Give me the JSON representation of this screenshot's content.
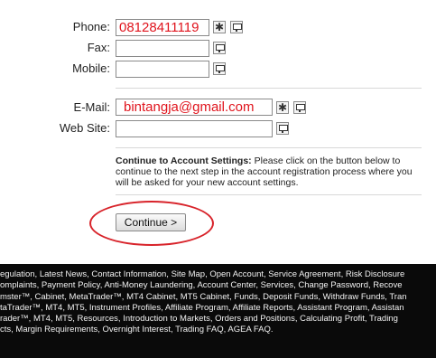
{
  "form": {
    "phone": {
      "label": "Phone:",
      "value": "08128411119"
    },
    "fax": {
      "label": "Fax:",
      "value": ""
    },
    "mobile": {
      "label": "Mobile:",
      "value": ""
    },
    "email": {
      "label": "E-Mail:",
      "value": "bintangja@gmail.com"
    },
    "website": {
      "label": "Web Site:",
      "value": ""
    },
    "required_glyph": "✱"
  },
  "note": {
    "heading": "Continue to Account Settings:",
    "text": " Please click on the button below to continue to the next step in the account registration process where you will be asked for your new account settings."
  },
  "continue_button": "Continue >",
  "footer_lines": [
    "egulation, Latest News, Contact Information, Site Map, Open Account, Service Agreement, Risk Disclosure",
    "omplaints, Payment Policy, Anti-Money Laundering, Account Center, Services, Change Password, Recove",
    "mster™, Cabinet, MetaTrader™, MT4 Cabinet, MT5 Cabinet, Funds, Deposit Funds, Withdraw Funds, Tran",
    "taTrader™, MT4, MT5, Instrument Profiles, Affiliate Program, Affiliate Reports, Assistant Program, Assistan",
    "rader™, MT4, MT5, Resources, Introduction to Markets, Orders and Positions, Calculating Profit, Trading",
    "cts, Margin Requirements, Overnight Interest, Trading FAQ, AGEA FAQ."
  ],
  "colors": {
    "annotation": "#d8232a",
    "input_text": "#e0141d",
    "footer_bg": "#0a0a0a"
  },
  "icons": {
    "required": "asterisk-icon",
    "public": "monitor-icon"
  }
}
